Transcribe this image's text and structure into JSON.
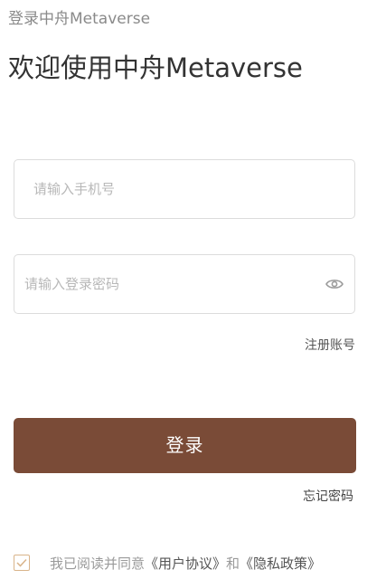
{
  "window": {
    "title": "登录中舟Metaverse"
  },
  "header": {
    "title": "欢迎使用中舟Metaverse"
  },
  "form": {
    "phone": {
      "placeholder": "请输入手机号",
      "value": ""
    },
    "password": {
      "placeholder": "请输入登录密码",
      "value": "",
      "toggle_icon": "eye-icon"
    }
  },
  "links": {
    "register": "注册账号",
    "forgot_password": "忘记密码"
  },
  "login_button": {
    "label": "登录",
    "color": "#7a4b37"
  },
  "agreement": {
    "checked": false,
    "prefix": "我已阅读并同意",
    "user_agreement": "《用户协议》",
    "conjunction": "和",
    "privacy_policy": "《隐私政策》"
  }
}
